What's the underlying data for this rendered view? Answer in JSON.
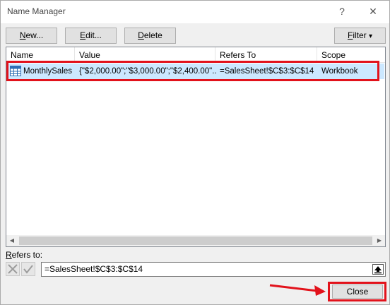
{
  "window": {
    "title": "Name Manager",
    "help_label": "?",
    "close_label": "✕"
  },
  "toolbar": {
    "new_label_u": "N",
    "new_label_rest": "ew...",
    "edit_label_u": "E",
    "edit_label_rest": "dit...",
    "delete_label_u": "D",
    "delete_label_rest": "elete",
    "filter_label_u": "F",
    "filter_label_rest": "ilter",
    "filter_arrow": "▾"
  },
  "table": {
    "columns": [
      "Name",
      "Value",
      "Refers To",
      "Scope"
    ],
    "rows": [
      {
        "name": "MonthlySales",
        "value": "{\"$2,000.00\";\"$3,000.00\";\"$2,400.00\"...",
        "refers_to": "=SalesSheet!$C$3:$C$14",
        "scope": "Workbook",
        "icon": "table-icon"
      }
    ]
  },
  "refers": {
    "label_u": "R",
    "label_rest": "efers to:",
    "value": "=SalesSheet!$C$3:$C$14"
  },
  "footer": {
    "close_label": "Close"
  },
  "colors": {
    "highlight": "#e2121b",
    "selection": "#cce8ff"
  }
}
